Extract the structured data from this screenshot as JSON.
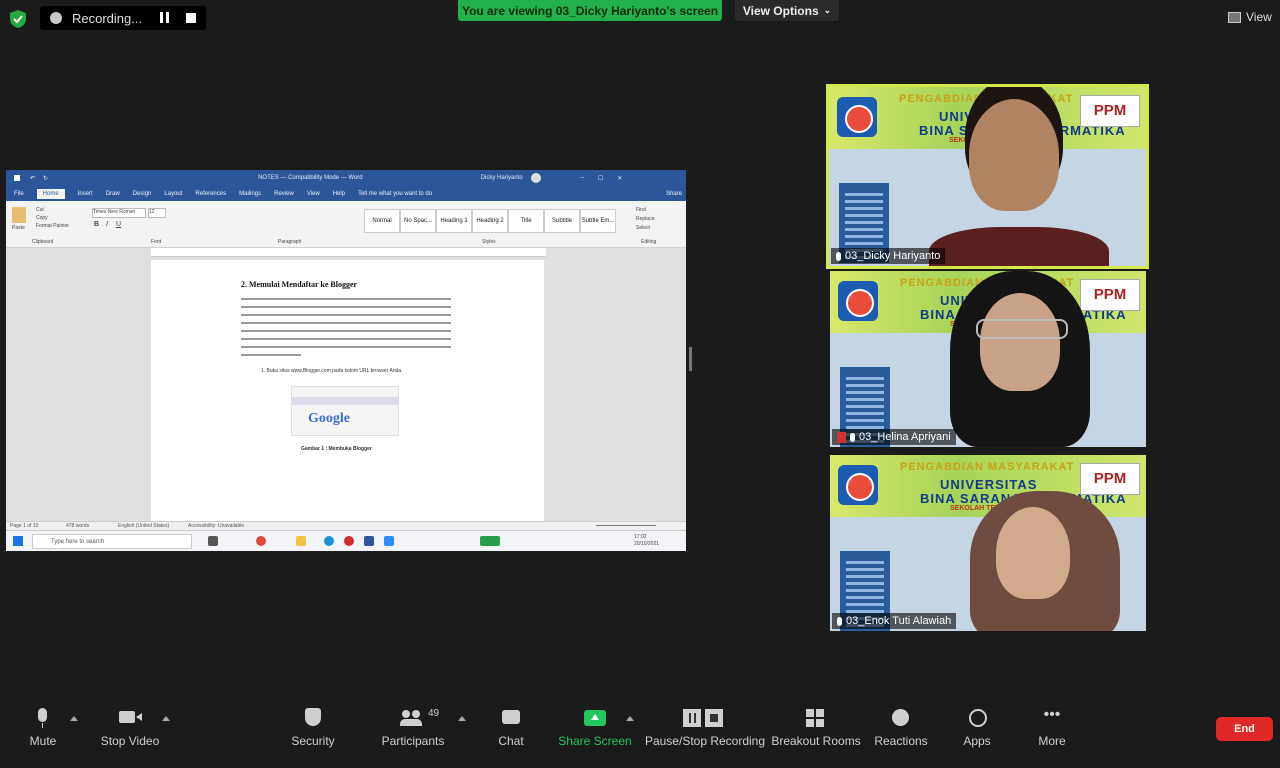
{
  "top_bar": {
    "recording_label": "Recording...",
    "viewing_banner": "You are viewing 03_Dicky Hariyanto's screen",
    "view_options": "View Options",
    "view_button": "View"
  },
  "shared_screen": {
    "window_title": "NOTES — Compatibility Mode — Word",
    "user": "Dicky Hariyanto",
    "ribbon_tabs": [
      "File",
      "Home",
      "Insert",
      "Draw",
      "Design",
      "Layout",
      "References",
      "Mailings",
      "Review",
      "View",
      "Help",
      "Tell me what you want to do",
      "Share"
    ],
    "ribbon_groups": [
      "Clipboard",
      "Font",
      "Paragraph",
      "Styles",
      "Editing"
    ],
    "styles": [
      "Normal",
      "No Spac...",
      "Heading 1",
      "Heading 2",
      "Title",
      "Subtitle",
      "Subtle Em..."
    ],
    "clipboard": [
      "Cut",
      "Copy",
      "Format Painter",
      "Paste"
    ],
    "editing": [
      "Find",
      "Replace",
      "Select"
    ],
    "font_name": "Times New Roman",
    "font_size": "12",
    "doc_heading": "2.     Memulai Mendaftar ke Blogger",
    "doc_list_item": "1. Buka situs www.Blogger.com pada kolom URL browser Anda.",
    "image_text": "Google",
    "doc_caption": "Gambar 1 : Membuka Blogger",
    "status_bar": [
      "Page 1 of 10",
      "478 words",
      "English (United States)",
      "Accessibility: Unavailable"
    ],
    "taskbar_search": "Type here to search",
    "clock_time": "17:02",
    "clock_date": "20/10/2021"
  },
  "participants": [
    {
      "name": "03_Dicky Hariyanto",
      "muted": false,
      "active": true
    },
    {
      "name": "03_Helina Apriyani",
      "muted": true,
      "active": false
    },
    {
      "name": "03_Enok Tuti Alawiah",
      "muted": false,
      "active": false
    }
  ],
  "banner_text": {
    "line1": "PENGABDIAN MASYARAKAT",
    "line2": "UNIVERSITAS",
    "line3": "BINA SARANA INFORMATIKA",
    "line4": "SEKOLAH TEKNIK DIGITAL",
    "logo": "PPM"
  },
  "toolbar": {
    "mute": "Mute",
    "stop_video": "Stop Video",
    "security": "Security",
    "participants": "Participants",
    "participants_count": "49",
    "chat": "Chat",
    "share_screen": "Share Screen",
    "pause_stop_recording": "Pause/Stop Recording",
    "breakout_rooms": "Breakout Rooms",
    "reactions": "Reactions",
    "apps": "Apps",
    "more": "More",
    "end": "End"
  },
  "colors": {
    "viewing_banner": "#22b14c",
    "word_blue": "#2b579a",
    "end_button": "#e02828",
    "active_speaker_border": "#d4e84c"
  }
}
